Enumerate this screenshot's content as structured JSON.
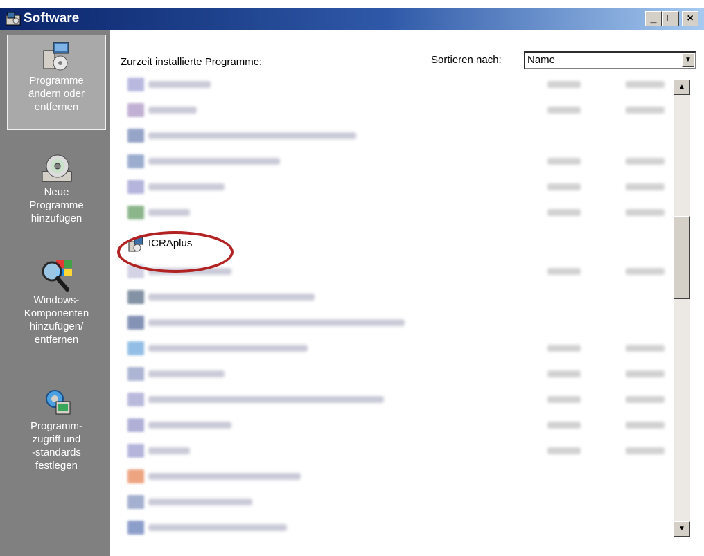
{
  "window": {
    "title": "Software",
    "minimize_label": "_",
    "maximize_label": "□",
    "close_label": "×"
  },
  "sidebar": {
    "items": [
      {
        "label": "Programme\nändern oder\nentfernen",
        "icon": "cd-box-icon",
        "active": true
      },
      {
        "label": "Neue\nProgramme\nhinzufügen",
        "icon": "cd-disc-icon",
        "active": false
      },
      {
        "label": "Windows-\nKomponenten\nhinzufügen/\nentfernen",
        "icon": "windows-magnifier-icon",
        "active": false
      },
      {
        "label": "Programm-\nzugriff und\n-standards\nfestlegen",
        "icon": "gear-monitor-icon",
        "active": false
      }
    ]
  },
  "content": {
    "list_header": "Zurzeit installierte Programme:",
    "sort_label": "Sortieren nach:",
    "sort_value": "Name",
    "highlighted_program": "ICRAplus"
  },
  "scrollbar": {
    "up_arrow": "▲",
    "down_arrow": "▼"
  },
  "colors": {
    "title_bar": "#0a246a",
    "sidebar": "#808080",
    "highlight": "#b22222"
  }
}
